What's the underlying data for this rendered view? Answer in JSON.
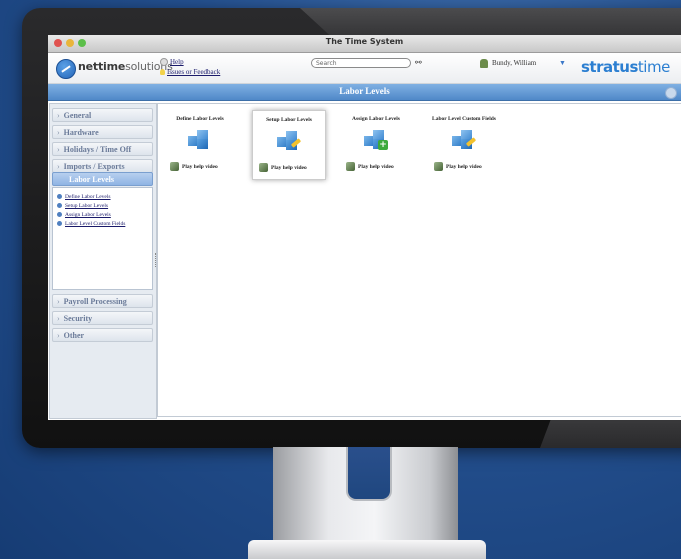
{
  "window": {
    "title": "The Time System"
  },
  "header": {
    "logo_bold": "nettime",
    "logo_light": "solutions",
    "help_label": "Help",
    "feedback_label": "Issues or Feedback",
    "search_placeholder": "Search",
    "user_name": "Bundy, William",
    "brand_bold": "stratus",
    "brand_light": "time"
  },
  "page": {
    "title": "Labor Levels"
  },
  "sidebar": {
    "items": [
      {
        "label": "General"
      },
      {
        "label": "Hardware"
      },
      {
        "label": "Holidays / Time Off"
      },
      {
        "label": "Imports / Exports"
      },
      {
        "label": "Labor Levels"
      },
      {
        "label": "Payroll Processing"
      },
      {
        "label": "Security"
      },
      {
        "label": "Other"
      }
    ],
    "sublinks": [
      {
        "label": "Define Labor Levels"
      },
      {
        "label": "Setup Labor Levels"
      },
      {
        "label": "Assign Labor Levels"
      },
      {
        "label": "Labor Level Custom Fields"
      }
    ]
  },
  "cards": [
    {
      "title": "Define Labor Levels",
      "video_label": "Play help video"
    },
    {
      "title": "Setup Labor Levels",
      "video_label": "Play help video"
    },
    {
      "title": "Assign Labor Levels",
      "video_label": "Play help video"
    },
    {
      "title": "Labor Level Custom Fields",
      "video_label": "Play help video"
    }
  ]
}
